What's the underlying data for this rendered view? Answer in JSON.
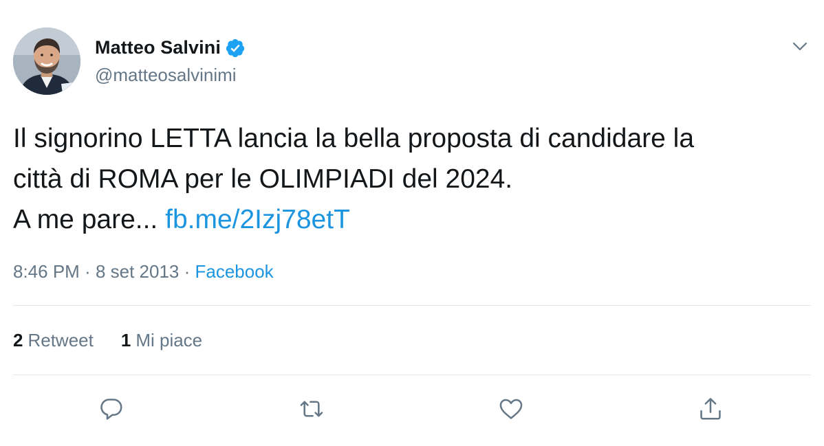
{
  "author": {
    "display_name": "Matteo Salvini",
    "handle": "@matteosalvinimi",
    "verified": true,
    "avatar_icon": "profile-photo"
  },
  "tweet": {
    "line1": "Il signorino LETTA lancia la bella proposta di candidare la",
    "line2": "città di ROMA per le OLIMPIADI del 2024.",
    "line3_text": "A me pare... ",
    "link": "fb.me/2Izj78etT"
  },
  "meta": {
    "time": "8:46 PM",
    "separator1": " · ",
    "date": "8 set 2013",
    "separator2": " · ",
    "source": "Facebook"
  },
  "stats": {
    "retweets_count": "2",
    "retweets_label": "Retweet",
    "likes_count": "1",
    "likes_label": "Mi piace"
  },
  "actions": [
    "reply-icon",
    "retweet-icon",
    "like-icon",
    "share-icon"
  ],
  "colors": {
    "accent": "#1b95e0",
    "verified": "#1da1f2",
    "secondary_text": "#657786",
    "primary_text": "#14171a",
    "divider": "#e1e8ed"
  }
}
